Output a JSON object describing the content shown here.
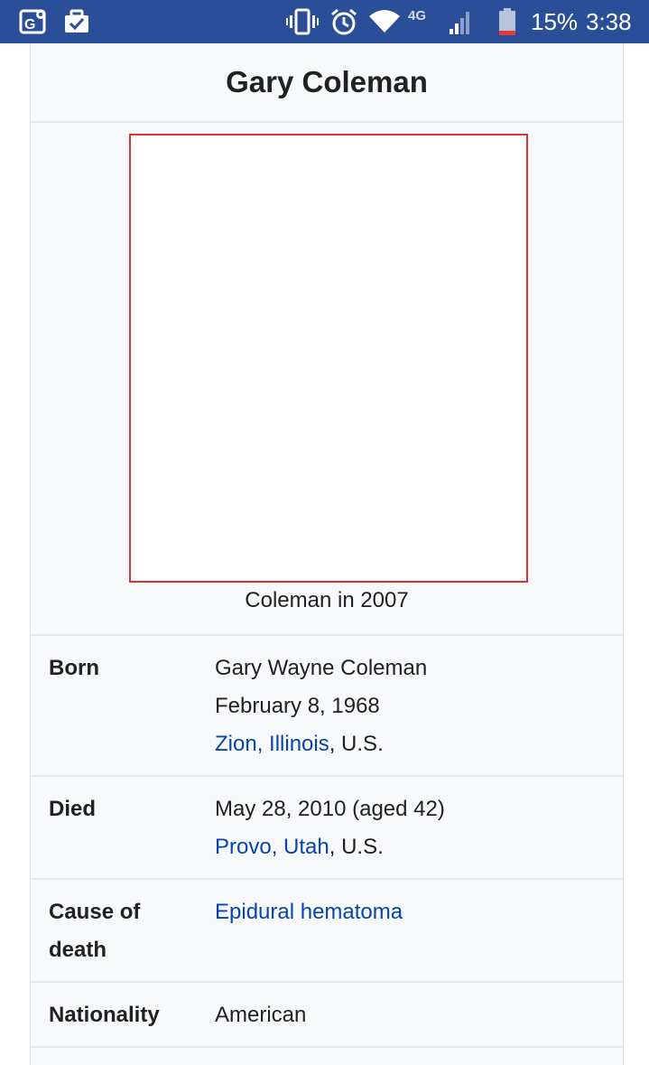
{
  "status_bar": {
    "battery_percent": "15%",
    "time": "3:38",
    "network_label": "4G",
    "icons": [
      "maps-notification-icon",
      "task-notification-icon",
      "vibrate-icon",
      "alarm-icon",
      "wifi-icon",
      "signal-icon",
      "battery-icon"
    ],
    "colors": {
      "background": "#2a4e97",
      "battery_low": "#e53935"
    }
  },
  "infobox": {
    "title": "Gary Coleman",
    "image_caption": "Coleman in 2007",
    "rows": [
      {
        "label": "Born",
        "lines": [
          {
            "text": "Gary Wayne Coleman"
          },
          {
            "text": "February 8, 1968"
          },
          {
            "link": "Zion, Illinois",
            "suffix": ", U.S."
          }
        ]
      },
      {
        "label": "Died",
        "lines": [
          {
            "text": "May 28, 2010 (aged 42)"
          },
          {
            "link": "Provo, Utah",
            "suffix": ", U.S."
          }
        ]
      },
      {
        "label_lines": [
          "Cause of",
          "death"
        ],
        "lines": [
          {
            "link": "Epidural hematoma"
          }
        ]
      },
      {
        "label": "Nationality",
        "lines": [
          {
            "text": "American"
          }
        ]
      }
    ],
    "colors": {
      "link": "#0645ad",
      "background": "#f8f9fa",
      "image_border": "#dd3333"
    }
  }
}
